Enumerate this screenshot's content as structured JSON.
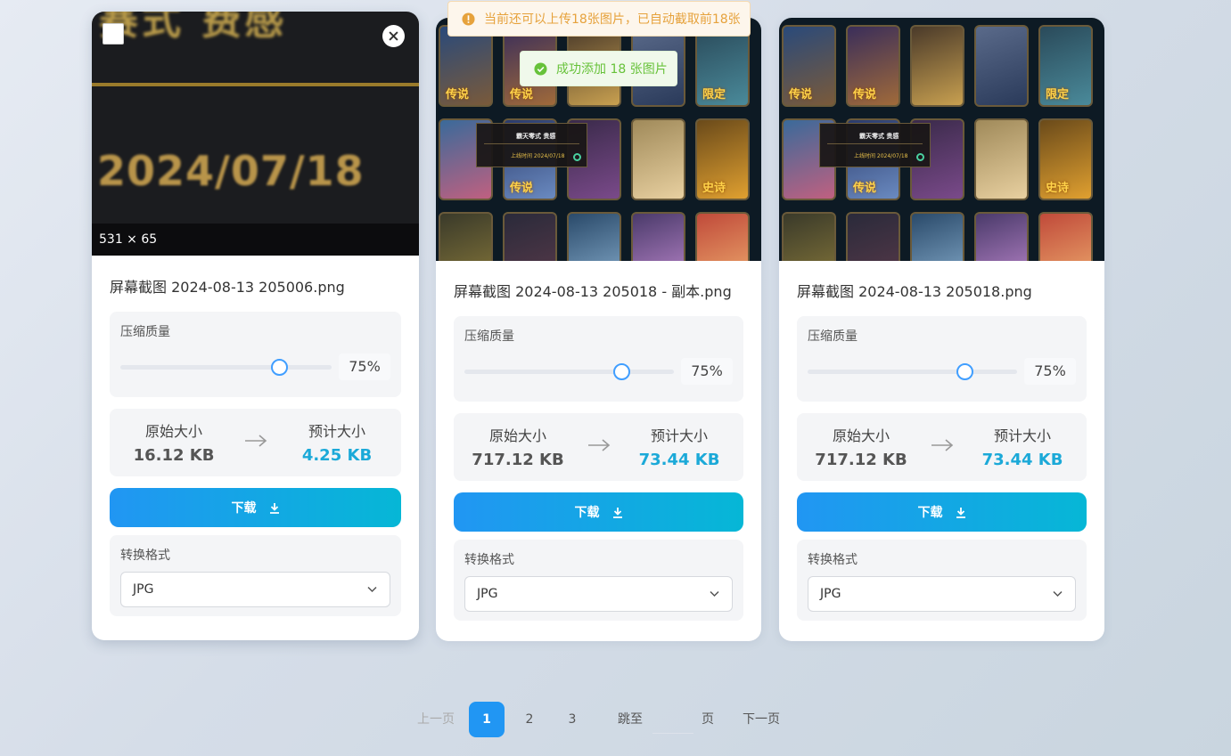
{
  "toasts": {
    "warning": "当前还可以上传18张图片，已自动截取前18张",
    "success": "成功添加 18 张图片"
  },
  "cards": [
    {
      "thumb_dimensions": "531 × 65",
      "thumb_top_text": "赛式 费感",
      "thumb_date_text": "2024/07/18",
      "filename": "屏幕截图 2024-08-13 205006.png",
      "quality_label": "压缩质量",
      "quality": 75,
      "quality_text": "75%",
      "original_label": "原始大小",
      "original_size": "16.12 KB",
      "estimated_label": "预计大小",
      "estimated_size": "4.25 KB",
      "download_label": "下载",
      "format_label": "转换格式",
      "format_value": "JPG"
    },
    {
      "filename": "屏幕截图 2024-08-13 205018 - 副本.png",
      "quality_label": "压缩质量",
      "quality": 75,
      "quality_text": "75%",
      "original_label": "原始大小",
      "original_size": "717.12 KB",
      "estimated_label": "预计大小",
      "estimated_size": "73.44 KB",
      "download_label": "下载",
      "format_label": "转换格式",
      "format_value": "JPG",
      "tile_labels": [
        "传说",
        "传说",
        "",
        "",
        "限定",
        "",
        "传说",
        "",
        "",
        "史诗",
        "",
        "",
        "",
        "",
        ""
      ],
      "tooltip_title": "霸天零式 贵感",
      "tooltip_sub": "上线时间 2024/07/18"
    },
    {
      "filename": "屏幕截图 2024-08-13 205018.png",
      "quality_label": "压缩质量",
      "quality": 75,
      "quality_text": "75%",
      "original_label": "原始大小",
      "original_size": "717.12 KB",
      "estimated_label": "预计大小",
      "estimated_size": "73.44 KB",
      "download_label": "下载",
      "format_label": "转换格式",
      "format_value": "JPG",
      "tile_labels": [
        "传说",
        "传说",
        "",
        "",
        "限定",
        "",
        "传说",
        "",
        "",
        "史诗",
        "",
        "",
        "",
        "",
        ""
      ],
      "tooltip_title": "霸天零式 贵感",
      "tooltip_sub": "上线时间 2024/07/18"
    }
  ],
  "pagination": {
    "prev": "上一页",
    "pages": [
      "1",
      "2",
      "3"
    ],
    "current_page": "1",
    "jump_prefix": "跳至",
    "jump_suffix": "页",
    "next": "下一页"
  },
  "colors": {
    "primary": "#2196f3",
    "accent_cyan": "#06b7d6",
    "estimated_text": "#1ba9d8",
    "warning": "#e6a23c",
    "success": "#67c23a"
  },
  "icons": {
    "checkbox": "checkbox-icon",
    "close": "close-icon",
    "arrow": "arrow-right-icon",
    "download": "download-icon",
    "dropdown": "chevron-down-icon",
    "warning": "warning-icon",
    "success": "check-circle-icon"
  }
}
